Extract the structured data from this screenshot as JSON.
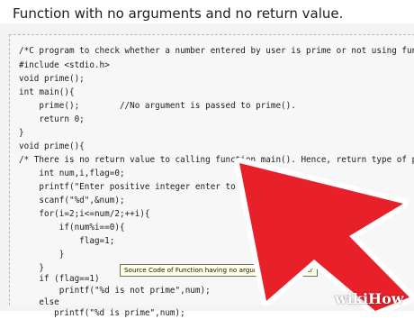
{
  "heading": "Function with no arguments and no return value.",
  "code_lines": [
    "/*C program to check whether a number entered by user is prime or not using fun",
    "#include <stdio.h>",
    "void prime();",
    "int main(){",
    "    prime();        //No argument is passed to prime().",
    "    return 0;",
    "}",
    "void prime(){",
    "/* There is no return value to calling function main(). Hence, return type of p",
    "    int num,i,flag=0;",
    "    printf(\"Enter positive integer enter to c",
    "    scanf(\"%d\",&num);",
    "    for(i=2;i<=num/2;++i){",
    "        if(num%i==0){",
    "            flag=1;",
    "        }",
    "    }",
    "    if (flag==1)",
    "        printf(\"%d is not prime\",num);",
    "    else",
    "       printf(\"%d is prime\",num);"
  ],
  "tooltip": "Source Code of Function having no argument and no retur",
  "watermark": {
    "wiki": "wiki",
    "how": "How"
  },
  "colors": {
    "cursor": "#e8202a",
    "cursor_outline": "#ffffff",
    "keyword": "#1c1c9e",
    "string": "#b0241a"
  }
}
